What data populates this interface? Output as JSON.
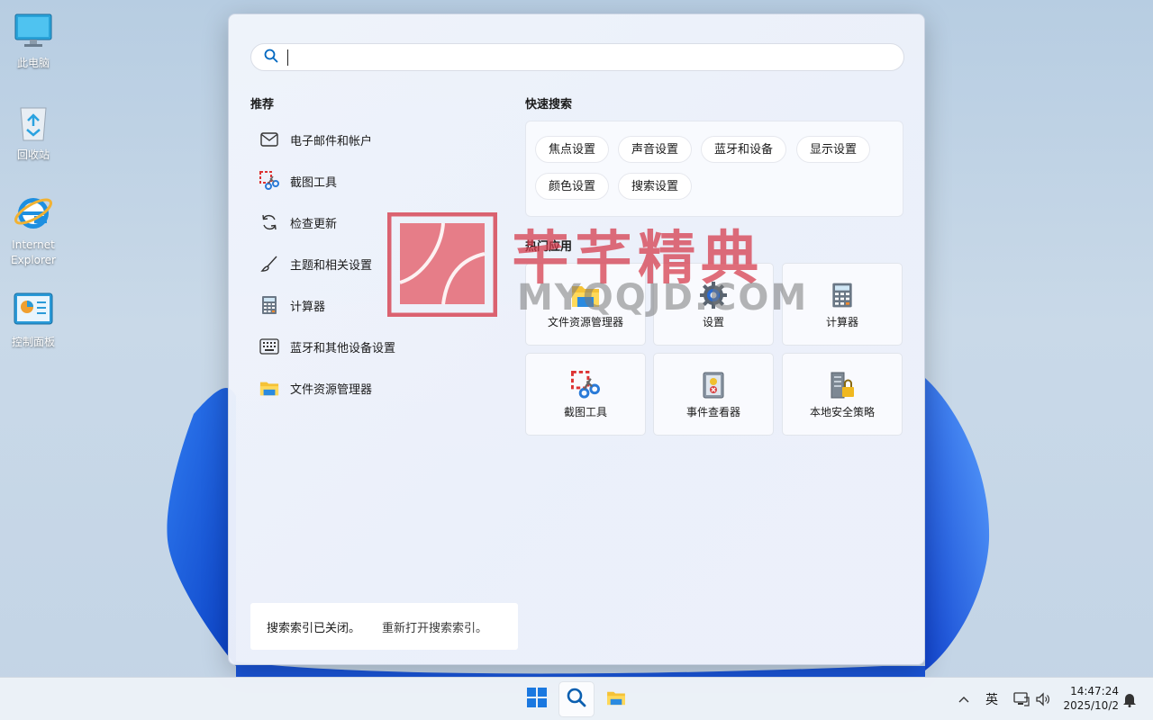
{
  "desktop": {
    "icons": [
      {
        "label": "此电脑",
        "icon": "monitor-icon"
      },
      {
        "label": "回收站",
        "icon": "recycle-bin-icon"
      },
      {
        "label": "Internet",
        "label2": "Explorer",
        "icon": "internet-explorer-icon"
      },
      {
        "label": "控制面板",
        "icon": "control-panel-icon"
      }
    ]
  },
  "search": {
    "value": "",
    "placeholder": ""
  },
  "recommended": {
    "title": "推荐",
    "items": [
      {
        "label": "电子邮件和帐户",
        "icon": "mail-icon"
      },
      {
        "label": "截图工具",
        "icon": "snipping-tool-icon"
      },
      {
        "label": "检查更新",
        "icon": "refresh-icon"
      },
      {
        "label": "主题和相关设置",
        "icon": "brush-icon"
      },
      {
        "label": "计算器",
        "icon": "calculator-icon"
      },
      {
        "label": "蓝牙和其他设备设置",
        "icon": "keyboard-icon"
      },
      {
        "label": "文件资源管理器",
        "icon": "folder-icon"
      }
    ]
  },
  "quick_search": {
    "title": "快速搜索",
    "chips": [
      "焦点设置",
      "声音设置",
      "蓝牙和设备",
      "显示设置",
      "颜色设置",
      "搜索设置"
    ]
  },
  "top_apps": {
    "title": "热门应用",
    "apps": [
      {
        "label": "文件资源管理器",
        "icon": "folder-icon"
      },
      {
        "label": "设置",
        "icon": "gear-icon"
      },
      {
        "label": "计算器",
        "icon": "calculator-icon"
      },
      {
        "label": "截图工具",
        "icon": "snipping-tool-icon"
      },
      {
        "label": "事件查看器",
        "icon": "event-viewer-icon"
      },
      {
        "label": "本地安全策略",
        "icon": "security-policy-icon"
      }
    ]
  },
  "index_notice": {
    "text": "搜索索引已关闭。",
    "link": "重新打开搜索索引。"
  },
  "watermark": {
    "cn": "芊芊精典",
    "en": "MYQQJD.COM"
  },
  "taskbar": {
    "tray": {
      "ime": "英",
      "time": "14:47:24",
      "date": "2025/10/2"
    }
  },
  "colors": {
    "accent": "#0067c0",
    "watermark_red": "#d63e4e",
    "taskbar_bg": "#ecf1f8"
  }
}
